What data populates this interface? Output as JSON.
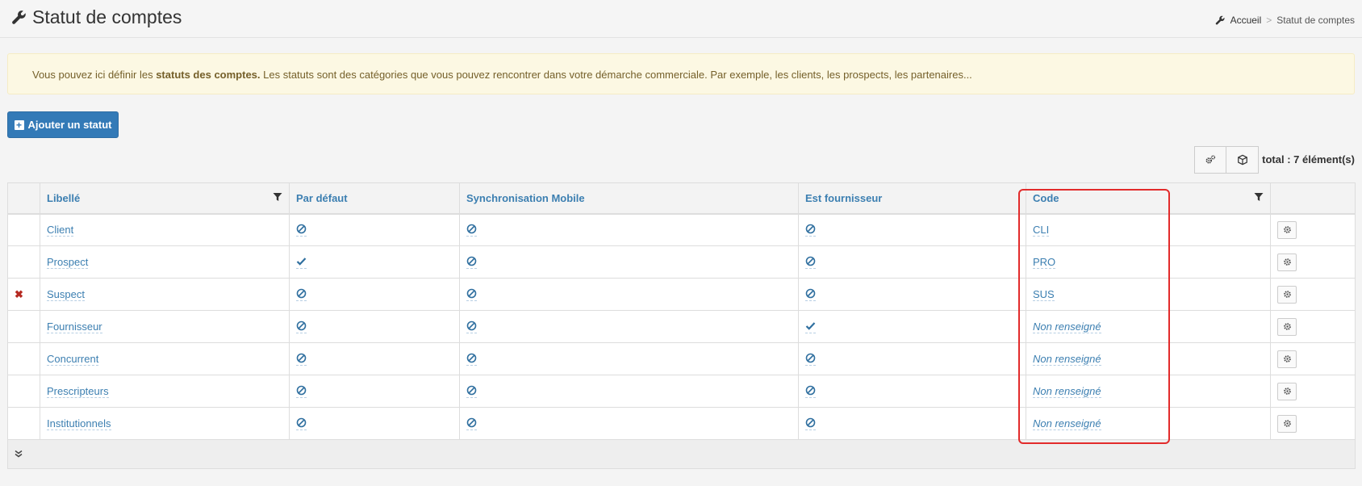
{
  "header": {
    "title": "Statut de comptes",
    "breadcrumb": {
      "home": "Accueil",
      "separator": ">",
      "current": "Statut de comptes"
    }
  },
  "alert": {
    "prefix": "Vous pouvez ici définir les ",
    "bold": "statuts des comptes.",
    "suffix": " Les statuts sont des catégories que vous pouvez rencontrer dans votre démarche commerciale. Par exemple, les clients, les prospects, les partenaires..."
  },
  "toolbar": {
    "add_label": "Ajouter un statut",
    "total": "total : 7 élément(s)"
  },
  "table": {
    "columns": [
      "Libellé",
      "Par défaut",
      "Synchronisation Mobile",
      "Est fournisseur",
      "Code"
    ],
    "rows": [
      {
        "label": "Client",
        "default": "no",
        "mobile": "no",
        "supplier": "no",
        "code": "CLI",
        "deleted": false
      },
      {
        "label": "Prospect",
        "default": "yes",
        "mobile": "no",
        "supplier": "no",
        "code": "PRO",
        "deleted": false
      },
      {
        "label": "Suspect",
        "default": "no",
        "mobile": "no",
        "supplier": "no",
        "code": "SUS",
        "deleted": true
      },
      {
        "label": "Fournisseur",
        "default": "no",
        "mobile": "no",
        "supplier": "yes",
        "code": "Non renseigné",
        "deleted": false
      },
      {
        "label": "Concurrent",
        "default": "no",
        "mobile": "no",
        "supplier": "no",
        "code": "Non renseigné",
        "deleted": false
      },
      {
        "label": "Prescripteurs",
        "default": "no",
        "mobile": "no",
        "supplier": "no",
        "code": "Non renseigné",
        "deleted": false
      },
      {
        "label": "Institutionnels",
        "default": "no",
        "mobile": "no",
        "supplier": "no",
        "code": "Non renseigné",
        "deleted": false
      }
    ]
  },
  "colors": {
    "accent": "#337ab7",
    "link": "#3c7fb1",
    "delete": "#b52a22",
    "highlight": "#e22b2b",
    "alert_bg": "#fcf8e3"
  },
  "icons": {
    "title": "wrench-icon",
    "filter": "filter-icon",
    "no": "ban-icon",
    "yes": "check-icon",
    "row_action": "gear-icon",
    "expand": "double-chevron-down-icon"
  }
}
